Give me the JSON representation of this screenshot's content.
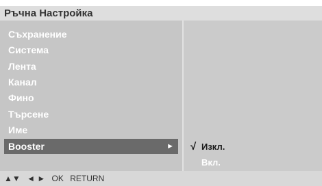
{
  "title": "Ръчна Настройка",
  "menu": [
    {
      "label": "Съхранение"
    },
    {
      "label": "Система"
    },
    {
      "label": "Лента"
    },
    {
      "label": "Канал"
    },
    {
      "label": "Фино"
    },
    {
      "label": "Търсене"
    },
    {
      "label": "Име"
    },
    {
      "label": "Booster",
      "arrow": "►"
    }
  ],
  "options": {
    "check": "√",
    "off": "Изкл.",
    "on": "Вкл."
  },
  "footer": {
    "updown": "▲▼",
    "leftright": "◄ ►",
    "ok": "OK",
    "return": "RETURN"
  }
}
